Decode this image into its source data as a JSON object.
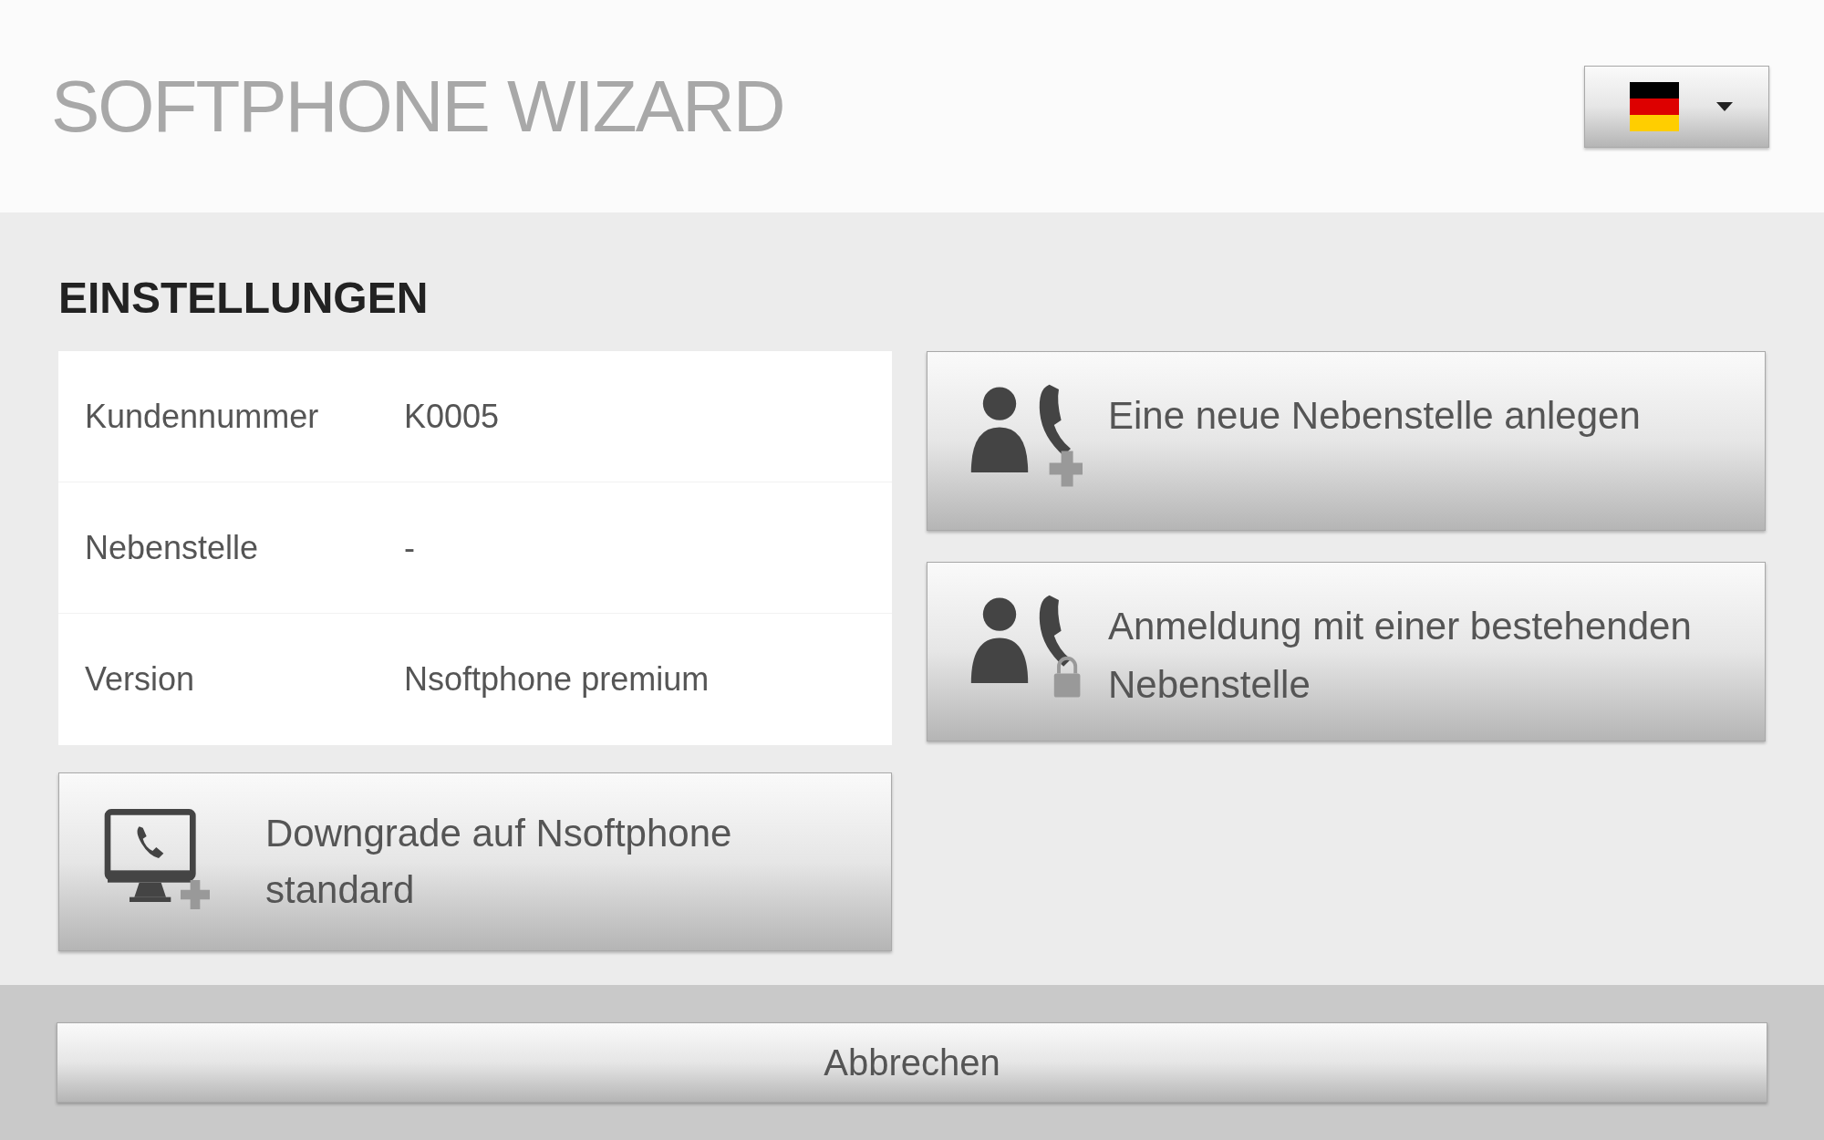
{
  "header": {
    "title": "SOFTPHONE WIZARD"
  },
  "settings": {
    "heading": "EINSTELLUNGEN",
    "rows": [
      {
        "label": "Kundennummer",
        "value": "K0005"
      },
      {
        "label": "Nebenstelle",
        "value": "-"
      },
      {
        "label": "Version",
        "value": "Nsoftphone premium"
      }
    ],
    "downgrade_button": {
      "kind": "monitor",
      "label": "Downgrade auf Nsoftphone standard"
    }
  },
  "actions": [
    {
      "kind": "add",
      "label": "Eine neue Nebenstelle anlegen"
    },
    {
      "kind": "lock",
      "label": "Anmeldung mit einer bestehenden Nebenstelle"
    }
  ],
  "footer": {
    "cancel_button": "Abbrechen"
  }
}
